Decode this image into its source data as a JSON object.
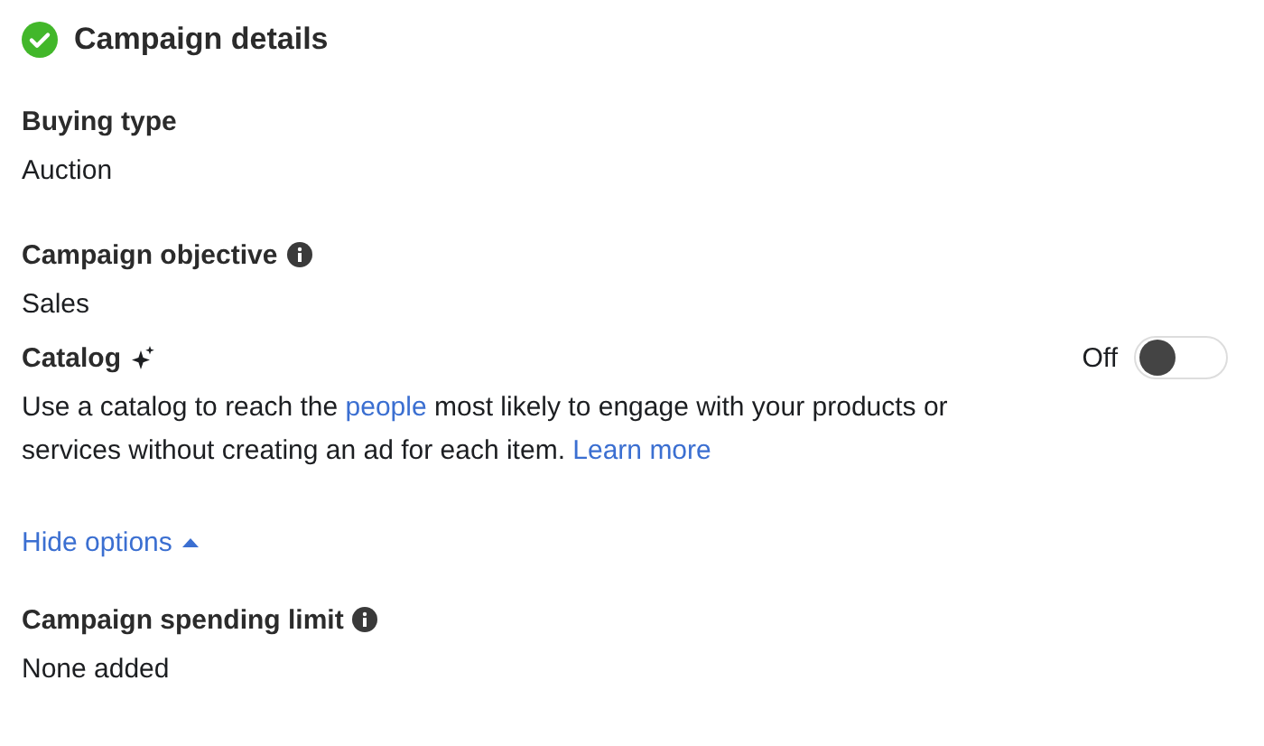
{
  "section": {
    "title": "Campaign details",
    "complete": true
  },
  "fields": [
    {
      "label": "Buying type",
      "info": false,
      "value": "Auction"
    },
    {
      "label": "Campaign objective",
      "info": true,
      "value": "Sales"
    }
  ],
  "catalog": {
    "label": "Catalog",
    "toggle_label": "Off",
    "on": false,
    "description": [
      {
        "text": "Use a catalog to reach the ",
        "link": false
      },
      {
        "text": "people",
        "link": true
      },
      {
        "text": " most likely to engage with your products or services without creating an ad for each item. ",
        "link": false
      },
      {
        "text": "Learn more",
        "link": true
      }
    ]
  },
  "options_link": {
    "label": "Hide options",
    "expanded": true
  },
  "spending_limit": {
    "label": "Campaign spending limit",
    "info": true,
    "value": "None added"
  }
}
